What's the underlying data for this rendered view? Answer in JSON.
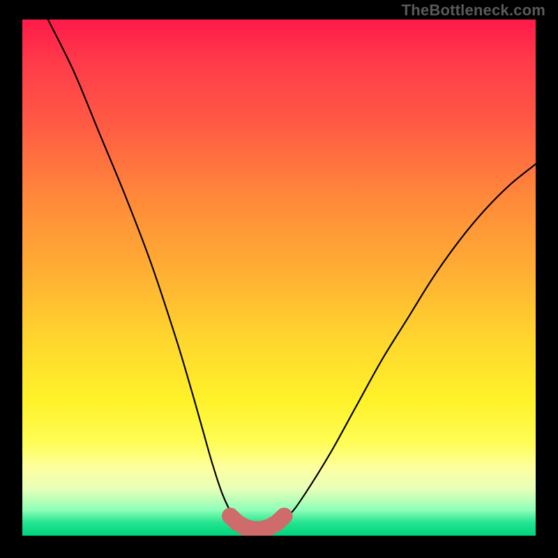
{
  "watermark": "TheBottleneck.com",
  "chart_data": {
    "type": "line",
    "title": "",
    "xlabel": "",
    "ylabel": "",
    "xlim": [
      0,
      100
    ],
    "ylim": [
      0,
      100
    ],
    "annotations": [],
    "series": [
      {
        "name": "bottleneck-curve",
        "x": [
          5,
          10,
          15,
          20,
          25,
          30,
          33,
          35,
          37,
          39,
          41,
          43,
          45,
          47,
          49,
          52,
          55,
          60,
          65,
          70,
          75,
          80,
          85,
          90,
          95,
          100
        ],
        "y": [
          100,
          90,
          78,
          66,
          53,
          38,
          28,
          21,
          14,
          8,
          4,
          2,
          1,
          1,
          2,
          4,
          8,
          16,
          25,
          34,
          42,
          50,
          57,
          63,
          68,
          72
        ],
        "style": "black-line"
      },
      {
        "name": "bottom-markers-left",
        "x": [
          40.5,
          42,
          43.5,
          45,
          46.5,
          48,
          49.5,
          51
        ],
        "y": [
          3.8,
          2.4,
          1.6,
          1.2,
          1.2,
          1.6,
          2.4,
          3.8
        ],
        "style": "marker-dots"
      }
    ],
    "background_gradient_stops": [
      {
        "pos": 0.0,
        "color": "#ff1a4a"
      },
      {
        "pos": 0.5,
        "color": "#ffb233"
      },
      {
        "pos": 0.82,
        "color": "#fffd56"
      },
      {
        "pos": 1.0,
        "color": "#00d47a"
      }
    ]
  }
}
